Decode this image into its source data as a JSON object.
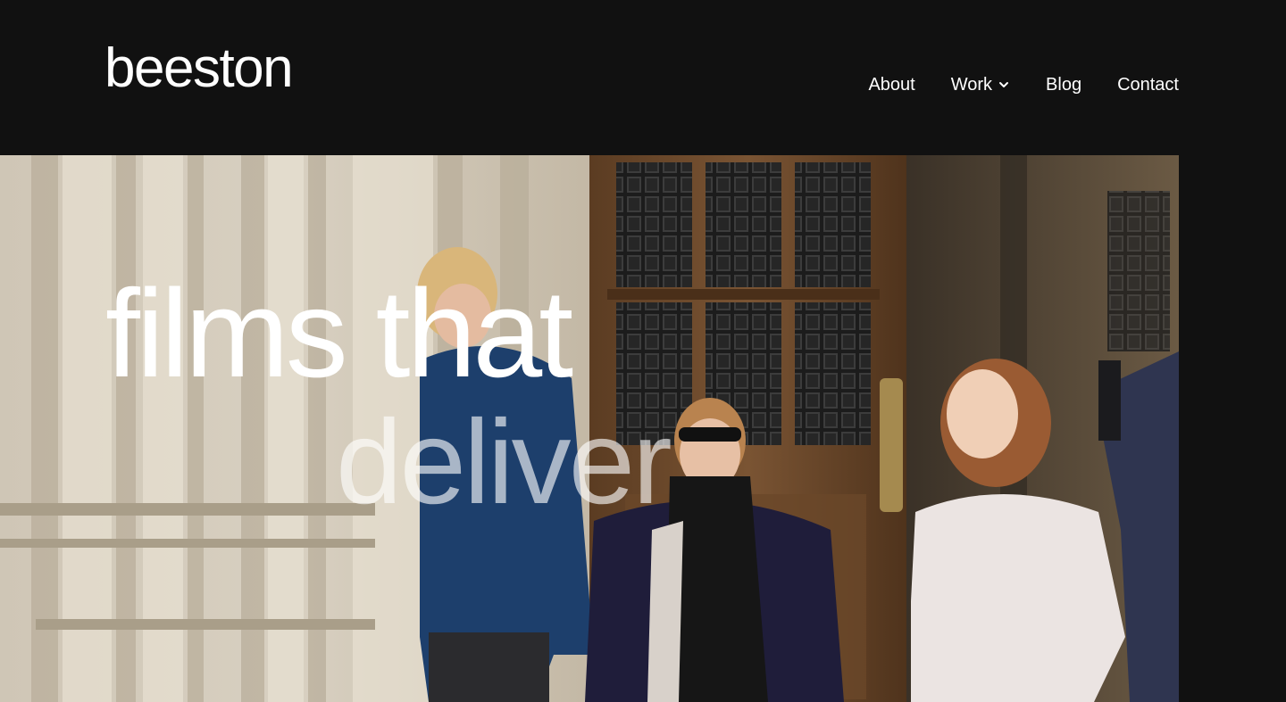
{
  "header": {
    "logo_text": "beeston",
    "nav": [
      {
        "label": "About"
      },
      {
        "label": "Work",
        "has_dropdown": true
      },
      {
        "label": "Blog"
      },
      {
        "label": "Contact"
      }
    ]
  },
  "hero": {
    "headline_line1": "films that",
    "headline_line2": "deliver",
    "background": "photo of students walking out of a wooden gothic doorway"
  },
  "colors": {
    "page_background": "#111111",
    "text": "#ffffff"
  }
}
